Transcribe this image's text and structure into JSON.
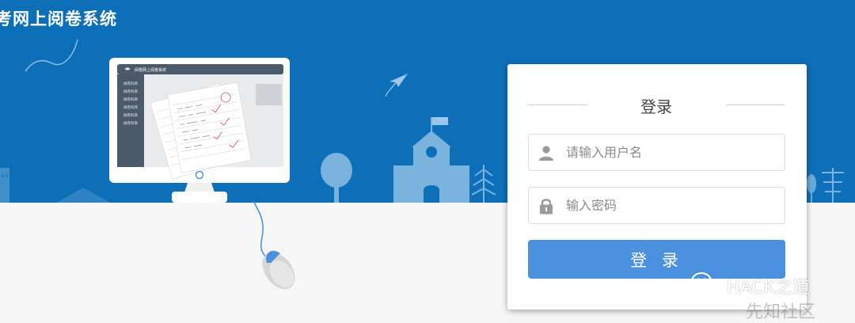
{
  "header": {
    "title": "考网上阅卷系统"
  },
  "monitor": {
    "screen_title": "阅卷网上阅卷系统",
    "menu_items": [
      "阅卷科目",
      "阅卷科目",
      "阅卷科目",
      "阅卷科目",
      "阅卷科目",
      "阅卷科目"
    ]
  },
  "login": {
    "heading": "登录",
    "username_placeholder": "请输入用户名",
    "password_placeholder": "输入密码",
    "button_label": "登 录"
  },
  "watermark": {
    "text": "HACK之道",
    "brand_text": "先知社区"
  },
  "colors": {
    "sky": "#0c6fb8",
    "button": "#4a92e0",
    "ground": "#f6f6f6"
  },
  "icons": {
    "username": "user-icon",
    "password": "lock-icon",
    "watermark": "wechat-icon"
  }
}
